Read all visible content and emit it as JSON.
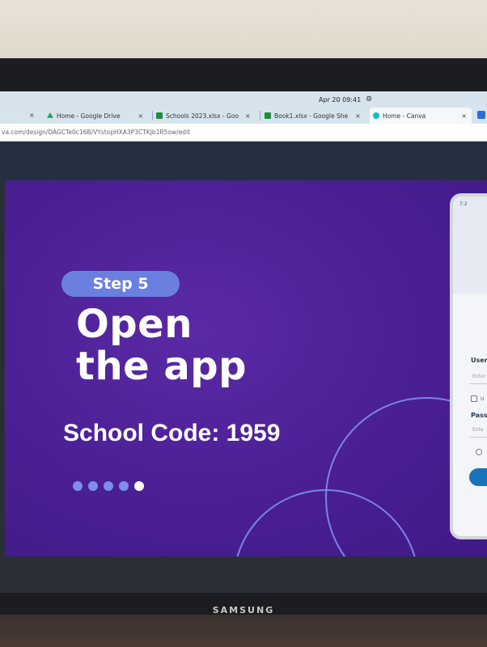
{
  "monitor": {
    "brand": "SAMSUNG"
  },
  "os": {
    "datetime": "Apr 20  09:41",
    "status_icon": "settings-gear-icon"
  },
  "browser": {
    "tabs": [
      {
        "label": "Home - Google Drive",
        "icon": "google-drive-icon",
        "color": "#1fa463"
      },
      {
        "label": "Schools 2023.xlsx - Goo",
        "icon": "google-sheets-icon",
        "color": "#1e8e3e"
      },
      {
        "label": "Book1.xlsx - Google She",
        "icon": "google-sheets-icon",
        "color": "#1e8e3e"
      },
      {
        "label": "Home - Canva",
        "icon": "canva-icon",
        "color": "#00c4cc"
      }
    ],
    "url": "va.com/design/DAGCTe0c16B/VYstopHXA3P3CTKJb1R5ow/edit"
  },
  "slide": {
    "step_label": "Step 5",
    "headline_line1": "Open",
    "headline_line2": "the app",
    "school_code": "School Code: 1959",
    "pagination": {
      "total": 5,
      "active_index": 4
    },
    "colors": {
      "background": "#4a1f93",
      "pill": "#6b7fe0",
      "ring": "#7c82ee",
      "accent_button": "#1a73b8"
    }
  },
  "phone_mockup": {
    "time": "7:2",
    "username_label": "Usern",
    "username_placeholder": "Enter",
    "remember_label": "U",
    "password_label": "Passw",
    "password_placeholder": "Ente"
  }
}
